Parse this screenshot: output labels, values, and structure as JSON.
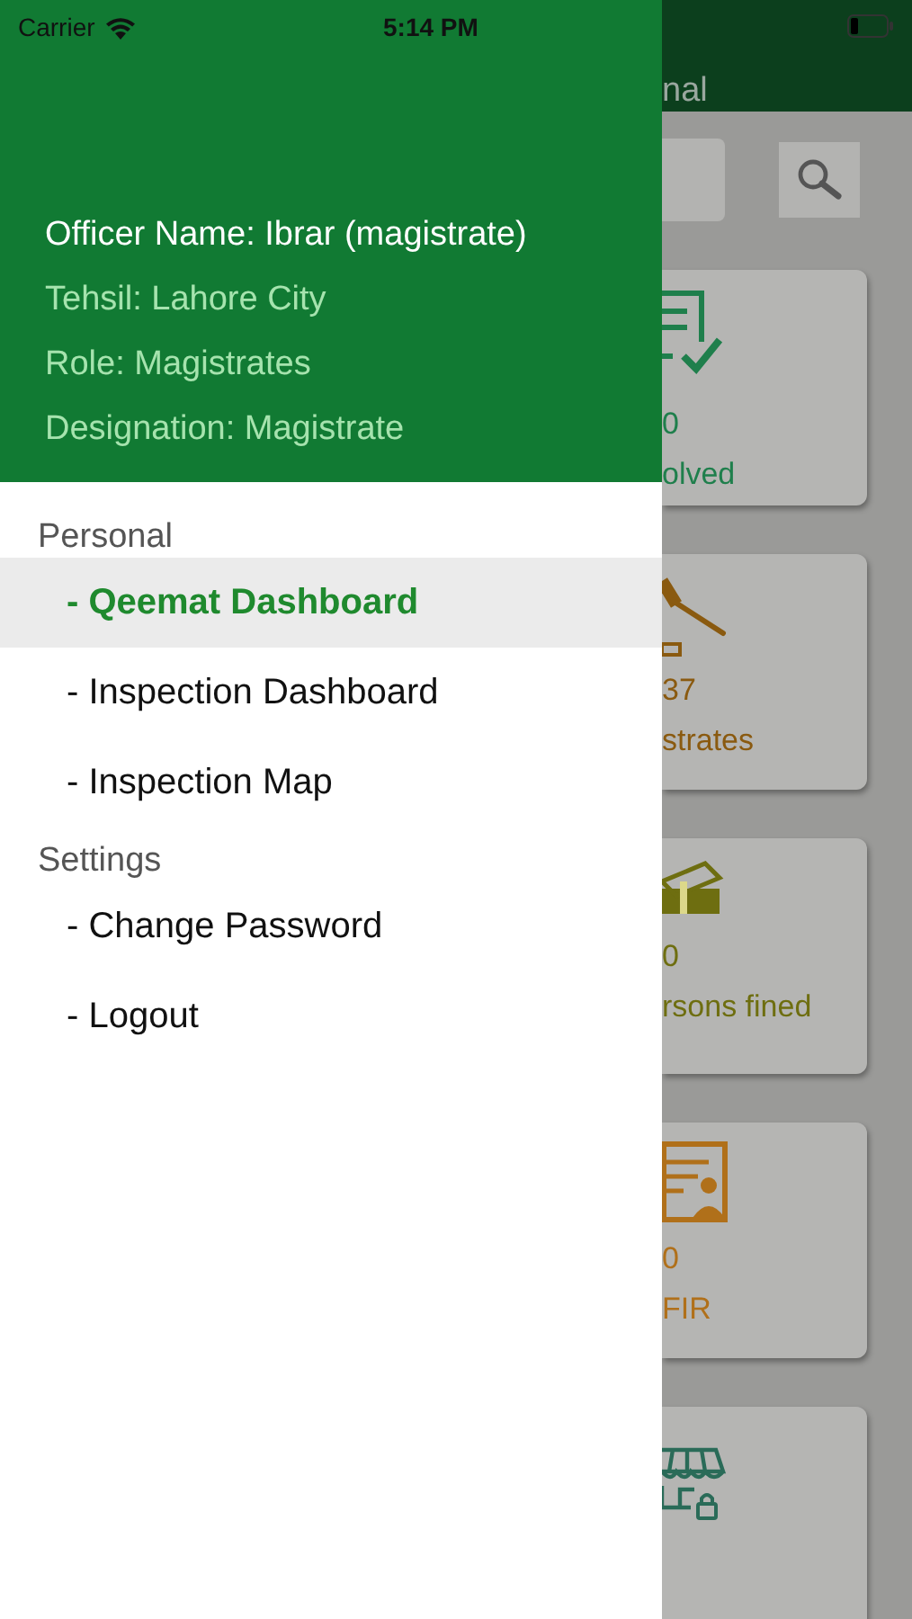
{
  "status_bar": {
    "carrier": "Carrier",
    "time": "5:14 PM"
  },
  "drawer": {
    "profile": [
      {
        "kind": "name",
        "text": "Officer Name: Ibrar (magistrate)"
      },
      {
        "kind": "detail",
        "text": "Tehsil: Lahore City"
      },
      {
        "kind": "detail",
        "text": "Role: Magistrates"
      },
      {
        "kind": "detail",
        "text": "Designation: Magistrate"
      }
    ],
    "sections": [
      {
        "title": "Personal",
        "items": [
          {
            "label": "- Qeemat Dashboard",
            "selected": true
          },
          {
            "label": "- Inspection Dashboard",
            "selected": false
          },
          {
            "label": "- Inspection Map",
            "selected": false
          }
        ]
      },
      {
        "title": "Settings",
        "items": [
          {
            "label": "- Change Password",
            "selected": false
          },
          {
            "label": "- Logout",
            "selected": false
          }
        ]
      }
    ]
  },
  "background_screen": {
    "title": "nal",
    "cards": [
      {
        "kind": "stat",
        "value": "0",
        "label": "olved"
      },
      {
        "kind": "stat",
        "value": "37",
        "label": "strates"
      },
      {
        "kind": "stat",
        "value": "0",
        "label": "rsons fined"
      },
      {
        "kind": "stat",
        "value": "0",
        "label": "FIR"
      },
      {
        "kind": "cut"
      }
    ]
  }
}
